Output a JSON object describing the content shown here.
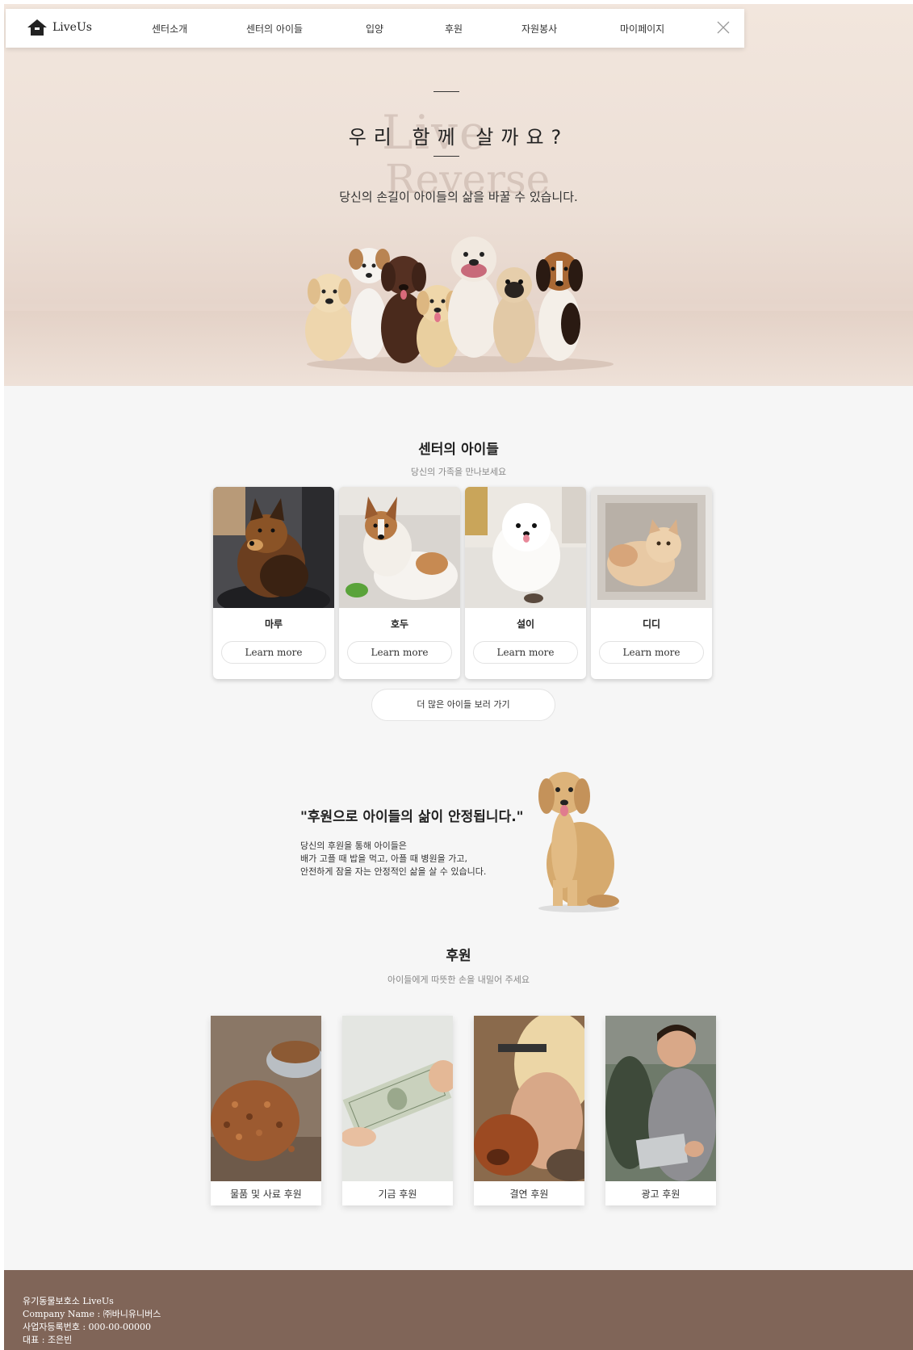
{
  "brand": {
    "name": "LiveUs"
  },
  "nav": {
    "items": [
      "센터소개",
      "센터의 아이들",
      "입양",
      "후원",
      "자원봉사",
      "마이페이지"
    ]
  },
  "hero": {
    "title": "우리 함께 살까요?",
    "subtitle": "당신의 손길이 아이들의 삶을 바꿀 수 있습니다.",
    "watermark_1": "Live",
    "watermark_2": "Reverse"
  },
  "pets_section": {
    "title": "센터의 아이들",
    "subtitle": "당신의 가족을 만나보세요",
    "cards": [
      {
        "name": "마루",
        "button": "Learn more"
      },
      {
        "name": "호두",
        "button": "Learn more"
      },
      {
        "name": "설이",
        "button": "Learn more"
      },
      {
        "name": "디디",
        "button": "Learn more"
      }
    ],
    "more_button": "더 많은 아이들 보러 가기"
  },
  "quote_section": {
    "quote": "\"후원으로 아이들의 삶이 안정됩니다.\"",
    "lines": [
      "당신의 후원을 통해 아이들은",
      "배가 고플 때 밥을 먹고, 아플 때 병원을 가고,",
      "안전하게 잠을 자는 안정적인 삶을 살 수 있습니다."
    ]
  },
  "donation_section": {
    "title": "후원",
    "subtitle": "아이들에게 따뜻한 손을 내밀어 주세요",
    "cards": [
      {
        "label": "물품 및 사료 후원"
      },
      {
        "label": "기금 후원"
      },
      {
        "label": "결연 후원"
      },
      {
        "label": "광고 후원"
      }
    ]
  },
  "footer": {
    "lines": [
      "유기동물보호소 LiveUs",
      "Company Name : ㈜바니유니버스",
      "사업자등록번호 : 000-00-00000",
      "대표 : 조은빈"
    ]
  },
  "colors": {
    "hero_bg": "#ecdfd6",
    "page_bg": "#f6f6f6",
    "footer_bg": "#806558"
  }
}
